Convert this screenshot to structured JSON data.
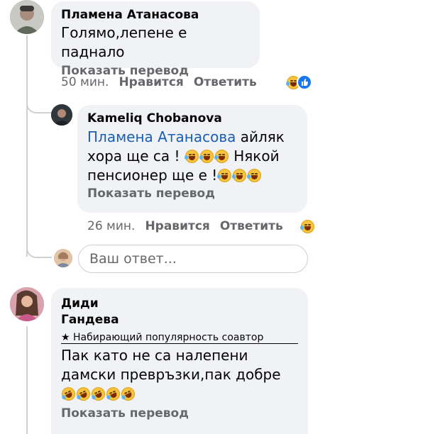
{
  "comments": [
    {
      "author": "Пламена Атанасова",
      "text": "Голямо,лепене е паднало",
      "translate_label": "Показать перевод",
      "time": "50 мин.",
      "like_label": "Нравится",
      "reply_label": "Ответить"
    },
    {
      "author": "Kameliq Chobanova",
      "mention": "Пламена Атанасова",
      "text_line1": " айляк",
      "text_line2": "хора ще са ! ",
      "text_line2b": " Някой",
      "text_line3": "пенсионер ще е !",
      "translate_label": "Показать перевод",
      "time": "26 мин.",
      "like_label": "Нравится",
      "reply_label": "Ответить"
    },
    {
      "author_line1": "Диди",
      "author_line2": "Гандева",
      "badge": "Набирающий популярность соавтор",
      "text_line1": "Пак като не са налепени",
      "text_line2": "дамски превръзки,пак добре",
      "translate_label": "Показать перевод"
    }
  ],
  "reply_box": {
    "placeholder": "Ваш ответ..."
  },
  "colors": {
    "bubble": "#f0f2f5",
    "mention": "#1b5fb3",
    "meta": "#65676b",
    "thread_line": "#ced0d4"
  },
  "icons": [
    "laughing-reaction-icon",
    "like-reaction-icon",
    "rolling-on-floor-laughing-emoji",
    "star-icon"
  ]
}
